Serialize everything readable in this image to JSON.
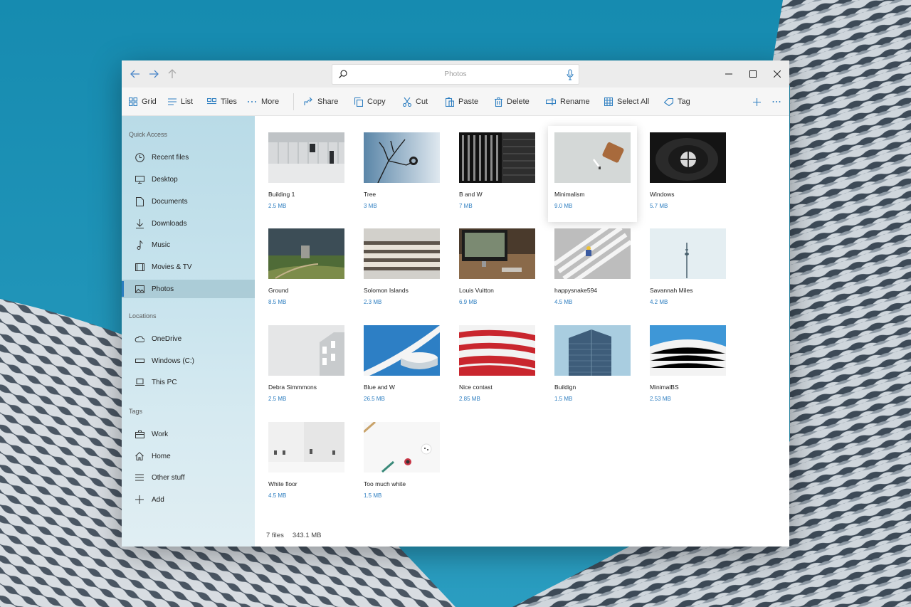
{
  "window": {
    "search": {
      "placeholder": "Photos",
      "value": ""
    }
  },
  "toolbar": {
    "grid": "Grid",
    "list": "List",
    "tiles": "Tiles",
    "more": "More",
    "share": "Share",
    "copy": "Copy",
    "cut": "Cut",
    "paste": "Paste",
    "delete": "Delete",
    "rename": "Rename",
    "select_all": "Select All",
    "tag": "Tag"
  },
  "sidebar": {
    "quick_access_heading": "Quick Access",
    "quick_access": [
      {
        "label": "Recent files",
        "icon": "clock-icon"
      },
      {
        "label": "Desktop",
        "icon": "desktop-icon"
      },
      {
        "label": "Documents",
        "icon": "document-icon"
      },
      {
        "label": "Downloads",
        "icon": "download-icon"
      },
      {
        "label": "Music",
        "icon": "music-icon"
      },
      {
        "label": "Movies & TV",
        "icon": "movie-icon"
      },
      {
        "label": "Photos",
        "icon": "photo-icon",
        "selected": true
      }
    ],
    "locations_heading": "Locations",
    "locations": [
      {
        "label": "OneDrive",
        "icon": "cloud-icon"
      },
      {
        "label": "Windows (C:)",
        "icon": "drive-icon"
      },
      {
        "label": "This PC",
        "icon": "laptop-icon"
      }
    ],
    "tags_heading": "Tags",
    "tags": [
      {
        "label": "Work",
        "icon": "briefcase-icon"
      },
      {
        "label": "Home",
        "icon": "home-icon"
      },
      {
        "label": "Other stuff",
        "icon": "list-icon"
      },
      {
        "label": "Add",
        "icon": "plus-icon"
      }
    ]
  },
  "files": [
    {
      "name": "Building 1",
      "size": "2.5 MB"
    },
    {
      "name": "Tree",
      "size": "3 MB"
    },
    {
      "name": "B and W",
      "size": "7 MB"
    },
    {
      "name": "Minimalism",
      "size": "9.0 MB",
      "hovered": true
    },
    {
      "name": "Windows",
      "size": "5.7 MB"
    },
    {
      "name": "Ground",
      "size": "8.5 MB"
    },
    {
      "name": "Solomon Islands",
      "size": "2.3 MB"
    },
    {
      "name": "Louis Vuitton",
      "size": "6.9 MB"
    },
    {
      "name": "happysnake594",
      "size": "4.5 MB"
    },
    {
      "name": "Savannah Miles",
      "size": "4.2 MB"
    },
    {
      "name": "Debra Simmmons",
      "size": "2.5 MB"
    },
    {
      "name": "Blue and W",
      "size": "26.5 MB"
    },
    {
      "name": "Nice contast",
      "size": "2.85 MB"
    },
    {
      "name": "Buildign",
      "size": "1.5 MB"
    },
    {
      "name": "MinimalBS",
      "size": "2.53 MB"
    },
    {
      "name": "White floor",
      "size": "4.5 MB"
    },
    {
      "name": "Too much white",
      "size": "1.5 MB"
    }
  ],
  "status": {
    "count": "7 files",
    "total_size": "343.1 MB"
  },
  "colors": {
    "accent": "#2f7fc1",
    "sidebar": "#c4e1eb",
    "titlebar": "#ececec"
  }
}
